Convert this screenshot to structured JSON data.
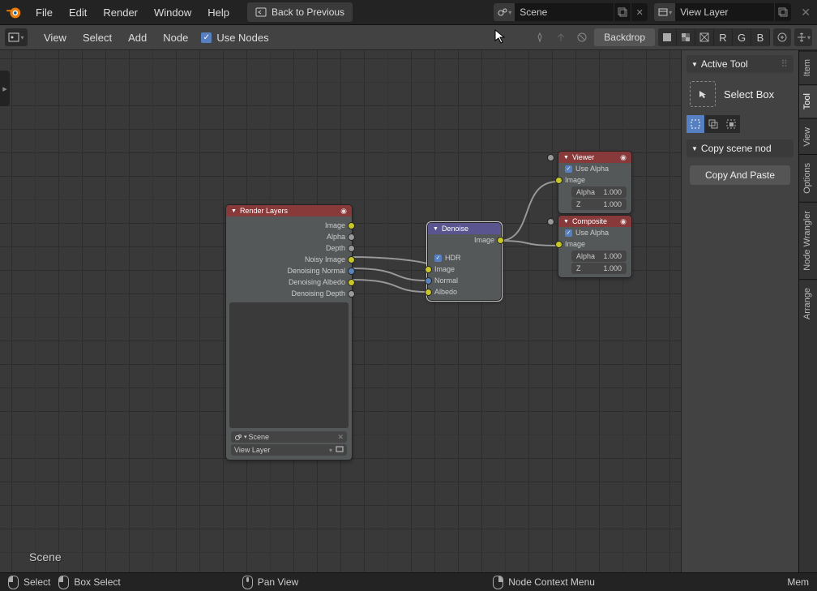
{
  "topmenu": {
    "file": "File",
    "edit": "Edit",
    "render": "Render",
    "window": "Window",
    "help": "Help",
    "back": "Back to Previous"
  },
  "scene_field": {
    "value": "Scene"
  },
  "layer_field": {
    "value": "View Layer"
  },
  "toolbar": {
    "view": "View",
    "select": "Select",
    "add": "Add",
    "node": "Node",
    "use_nodes": "Use Nodes",
    "backdrop": "Backdrop",
    "R": "R",
    "G": "G",
    "B": "B"
  },
  "side": {
    "active_tool": "Active Tool",
    "select_box": "Select Box",
    "copy_scene": "Copy scene nod",
    "copy_paste": "Copy And Paste"
  },
  "tabs": {
    "item": "Item",
    "tool": "Tool",
    "view": "View",
    "options": "Options",
    "wrangler": "Node Wrangler",
    "arrange": "Arrange"
  },
  "status": {
    "select": "Select",
    "box": "Box Select",
    "pan": "Pan View",
    "context": "Node Context Menu",
    "mem": "Mem"
  },
  "scene_label": "Scene",
  "nodes": {
    "render": {
      "title": "Render Layers",
      "outputs": [
        "Image",
        "Alpha",
        "Depth",
        "Noisy Image",
        "Denoising Normal",
        "Denoising Albedo",
        "Denoising Depth"
      ],
      "scene": "Scene",
      "viewlayer": "View Layer"
    },
    "denoise": {
      "title": "Denoise",
      "out": "Image",
      "hdr": "HDR",
      "inputs": [
        "Image",
        "Normal",
        "Albedo"
      ]
    },
    "viewer": {
      "title": "Viewer",
      "use_alpha": "Use Alpha",
      "image": "Image",
      "alpha": "Alpha",
      "z": "Z",
      "alpha_v": "1.000",
      "z_v": "1.000"
    },
    "composite": {
      "title": "Composite",
      "use_alpha": "Use Alpha",
      "image": "Image",
      "alpha": "Alpha",
      "z": "Z",
      "alpha_v": "1.000",
      "z_v": "1.000"
    }
  }
}
